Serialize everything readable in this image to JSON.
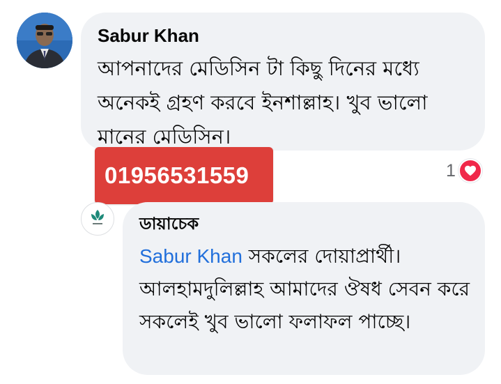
{
  "comment": {
    "author": "Sabur Khan",
    "text": "আপনাদের মেডিসিন টা কিছু দিনের মধ্যে অনেকই গ্রহণ করবে ইনশাল্লাহ। খুব ভালো মানের মেডিসিন।"
  },
  "overlay": {
    "phone": "01956531559",
    "badge_color": "#dd3f3a"
  },
  "reactions": {
    "count": "1",
    "icon": "heart-icon",
    "color": "#f0284a"
  },
  "reply": {
    "author": "ডায়াচেক",
    "mention": "Sabur Khan",
    "text": " সকলের দোয়াপ্রার্থী। আলহামদুলিল্লাহ আমাদের ঔষধ সেবন করে সকলেই খুব ভালো ফলাফল পাচ্ছে।",
    "mention_color": "#216fdb"
  }
}
